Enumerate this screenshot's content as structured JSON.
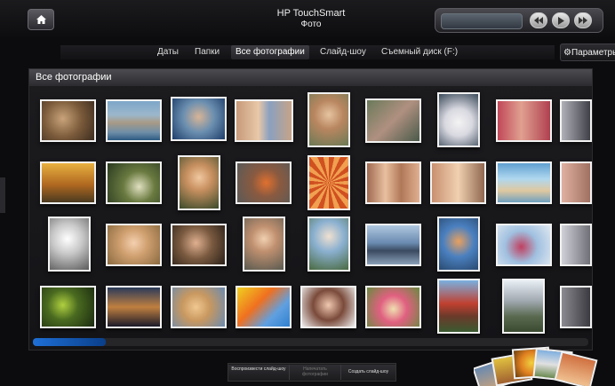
{
  "header": {
    "app_title": "HP TouchSmart",
    "section_title": "Фото",
    "home_icon": "home-icon",
    "player": {
      "rewind_icon": "rewind-icon",
      "play_icon": "play-icon",
      "forward_icon": "fast-forward-icon"
    }
  },
  "nav": {
    "tabs": [
      {
        "label": "Даты"
      },
      {
        "label": "Папки"
      },
      {
        "label": "Все фотографии"
      },
      {
        "label": "Слайд-шоу"
      },
      {
        "label": "Съемный диск (F:)"
      }
    ],
    "active_tab": "Все фотографии",
    "settings_label": "Параметры",
    "settings_icon": "gear-icon"
  },
  "panel": {
    "title": "Все фотографии"
  },
  "actions": {
    "play_slideshow": "Воспроизвести слайд-шоу",
    "print_photos": "Напечатать фотографии",
    "create_slideshow": "Создать слайд-шоу"
  },
  "colors": {
    "background": "#0c0c0e",
    "scroll_accent": "#1e6fd6"
  }
}
